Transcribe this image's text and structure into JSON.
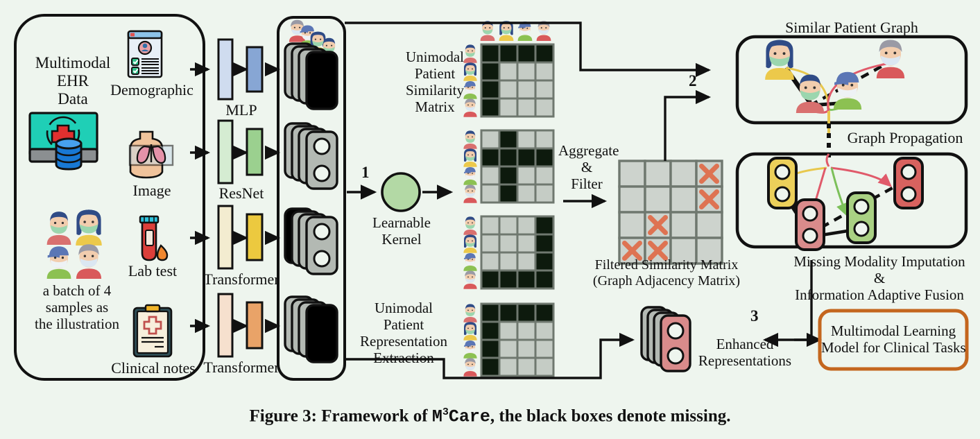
{
  "figure": {
    "caption_prefix": "Figure 3: Framework of ",
    "caption_model": "M",
    "caption_sup": "3",
    "caption_model2": "Care",
    "caption_suffix": ", the black boxes denote missing.",
    "background_color": "#eef5ee"
  },
  "input_panel": {
    "title": "Multimodal\nEHR\nData",
    "batch_note": "a batch of 4\nsamples as\nthe illustration",
    "modalities": [
      {
        "name": "Demographic",
        "icon": "demographic-form-icon"
      },
      {
        "name": "Image",
        "icon": "chest-xray-icon"
      },
      {
        "name": "Lab test",
        "icon": "blood-test-tube-icon"
      },
      {
        "name": "Clinical notes",
        "icon": "clipboard-notes-icon"
      }
    ],
    "ehr_icon": "ehr-database-monitor-icon",
    "patients_icon": "four-patients-icon"
  },
  "encoders": [
    {
      "label": "MLP",
      "color_light": "#cfdcef",
      "color_dark": "#87a6d4"
    },
    {
      "label": "ResNet",
      "color_light": "#d5ecd2",
      "color_dark": "#9bd08f"
    },
    {
      "label": "Transformer",
      "color_light": "#f3ecd0",
      "color_dark": "#ecc93f"
    },
    {
      "label": "Transformer",
      "color_light": "#f6e0ce",
      "color_dark": "#e9a368"
    }
  ],
  "representation_stacks": [
    {
      "modality": "demographic",
      "front_missing": true
    },
    {
      "modality": "image",
      "front_missing": false
    },
    {
      "modality": "lab-test",
      "front_missing": false
    },
    {
      "modality": "clinical-notes",
      "front_missing": true
    }
  ],
  "learnable_kernel": {
    "label": "Learnable\nKernel",
    "color": "#b3d9a5",
    "step": "1"
  },
  "similarity": {
    "label": "Unimodal\nPatient\nSimilarity\nMatrix",
    "extraction_label": "Unimodal\nPatient\nRepresentation\nExtraction",
    "aggregate_label": "Aggregate\n&\nFilter",
    "missing_color": "#0d1a0d",
    "present_color": "#c5ccc5",
    "grid_color": "#6f786f",
    "matrices": [
      {
        "name": "demographic-similarity-matrix",
        "cells": [
          [
            1,
            1,
            1,
            1
          ],
          [
            1,
            0,
            0,
            0
          ],
          [
            1,
            0,
            0,
            0
          ],
          [
            1,
            0,
            0,
            0
          ]
        ]
      },
      {
        "name": "image-similarity-matrix",
        "cells": [
          [
            0,
            1,
            0,
            0
          ],
          [
            1,
            1,
            1,
            1
          ],
          [
            0,
            1,
            0,
            0
          ],
          [
            0,
            1,
            0,
            0
          ]
        ]
      },
      {
        "name": "lab-test-similarity-matrix",
        "cells": [
          [
            0,
            0,
            0,
            1
          ],
          [
            0,
            0,
            0,
            1
          ],
          [
            0,
            0,
            0,
            1
          ],
          [
            1,
            1,
            1,
            1
          ]
        ]
      },
      {
        "name": "clinical-notes-similarity-matrix",
        "cells": [
          [
            1,
            1,
            1,
            1
          ],
          [
            1,
            0,
            0,
            0
          ],
          [
            1,
            0,
            0,
            0
          ],
          [
            1,
            0,
            0,
            0
          ]
        ]
      }
    ]
  },
  "filtered_matrix": {
    "caption": "Filtered Similarity Matrix\n(Graph Adjacency Matrix)",
    "cell_color": "#cdd3cd",
    "grid_color": "#6f786f",
    "x_color": "#de7352",
    "crosses": [
      [
        1,
        4
      ],
      [
        2,
        4
      ],
      [
        3,
        2
      ],
      [
        4,
        1
      ],
      [
        4,
        2
      ]
    ]
  },
  "steps": {
    "one": "1",
    "two": "2",
    "three": "3"
  },
  "similar_patient_graph": {
    "title": "Similar Patient Graph",
    "nodes": [
      "patient-yellow",
      "patient-red-left",
      "patient-green",
      "patient-red-right"
    ]
  },
  "graph_propagation": {
    "title": "Graph Propagation",
    "nodes": [
      {
        "name": "node-yellow",
        "color": "#ecd05a"
      },
      {
        "name": "node-red-left",
        "color": "#d98b8b"
      },
      {
        "name": "node-green",
        "color": "#a9d183"
      },
      {
        "name": "node-red-right",
        "color": "#d8625f"
      }
    ]
  },
  "fusion": {
    "label": "Missing Modality Imputation\n&\nInformation Adaptive Fusion"
  },
  "enhanced": {
    "label": "Enhanced\nRepresentations",
    "front_color": "#d98b8b"
  },
  "output_box": {
    "label": "Multimodal Learning\nModel for Clinical Tasks",
    "border_color": "#c4661e"
  }
}
